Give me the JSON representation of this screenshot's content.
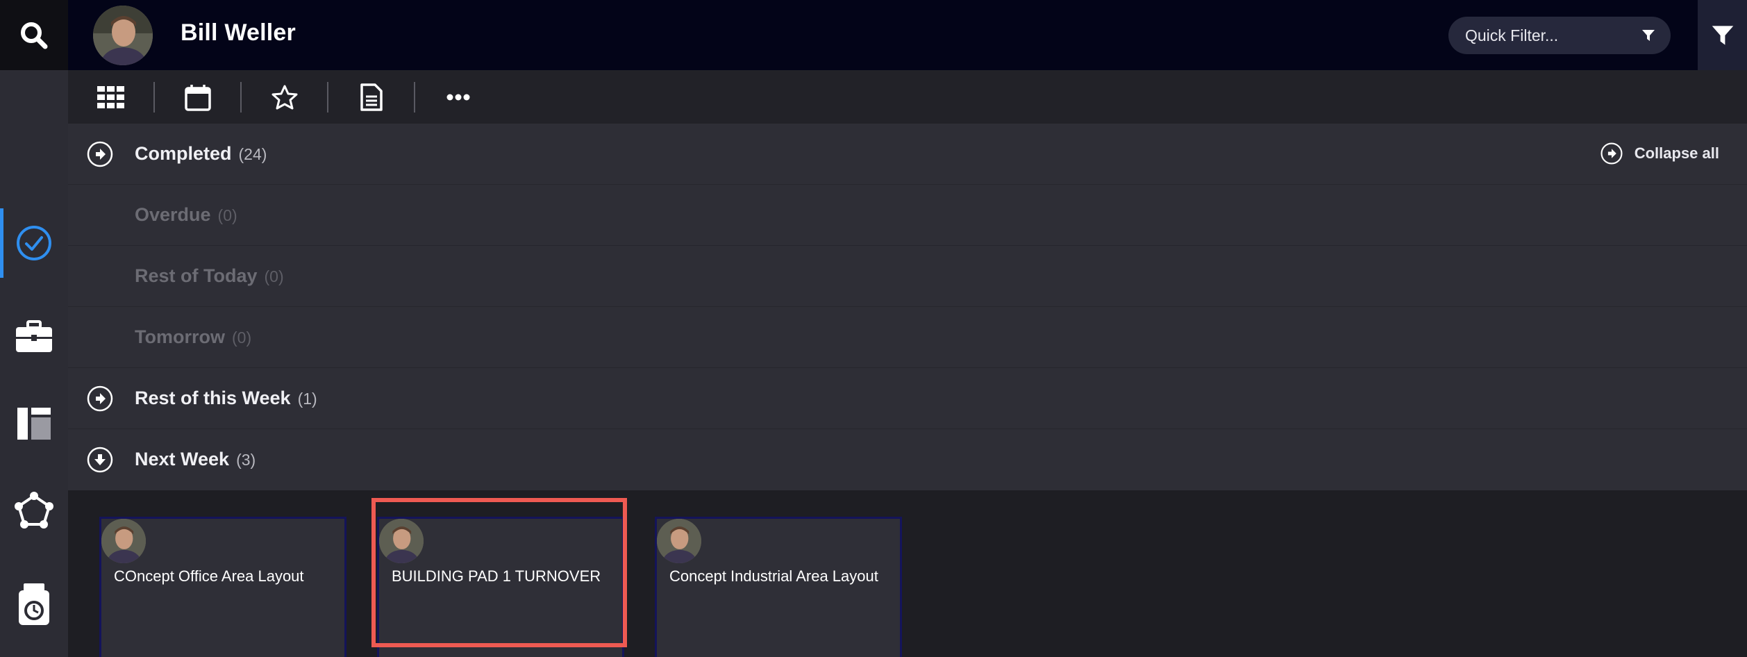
{
  "header": {
    "user_name": "Bill Weller",
    "quick_filter_placeholder": "Quick Filter..."
  },
  "rail": {
    "items": [
      {
        "name": "search-icon"
      },
      {
        "name": "tasks-check-icon",
        "active": true
      },
      {
        "name": "briefcase-icon"
      },
      {
        "name": "layout-icon"
      },
      {
        "name": "network-icon"
      },
      {
        "name": "timesheet-icon"
      }
    ]
  },
  "toolbar": {
    "buttons": [
      "grid-icon",
      "calendar-icon",
      "star-icon",
      "document-icon",
      "more-icon"
    ]
  },
  "groups": [
    {
      "label": "Completed",
      "count": "(24)",
      "state": "collapsed"
    },
    {
      "label": "Overdue",
      "count": "(0)",
      "state": "disabled"
    },
    {
      "label": "Rest of Today",
      "count": "(0)",
      "state": "disabled"
    },
    {
      "label": "Tomorrow",
      "count": "(0)",
      "state": "disabled"
    },
    {
      "label": "Rest of this Week",
      "count": "(1)",
      "state": "collapsed"
    },
    {
      "label": "Next Week",
      "count": "(3)",
      "state": "expanded"
    }
  ],
  "collapse_all_label": "Collapse all",
  "cards": [
    {
      "title": "COncept Office Area Layout"
    },
    {
      "title": "BUILDING PAD 1 TURNOVER"
    },
    {
      "title": "Concept Industrial Area Layout"
    }
  ],
  "colors": {
    "accent": "#2f8ff0",
    "highlight": "#ee5a52",
    "header_bg": "#030418"
  }
}
